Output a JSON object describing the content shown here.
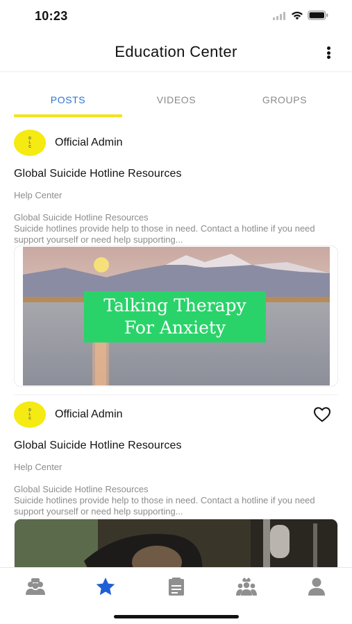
{
  "status_bar": {
    "time": "10:23"
  },
  "header": {
    "title": "Education Center"
  },
  "tabs": [
    {
      "label": "POSTS",
      "active": true
    },
    {
      "label": "VIDEOS",
      "active": false
    },
    {
      "label": "GROUPS",
      "active": false
    }
  ],
  "posts": [
    {
      "author": "Official Admin",
      "avatar_text": [
        "D",
        "L",
        "C"
      ],
      "title": "Global Suicide Hotline Resources",
      "category": "Help Center",
      "excerpt_title": "Global Suicide Hotline Resources",
      "excerpt": "Suicide hotlines provide help to those in need. Contact a hotline if you need support yourself or need help supporting...",
      "media": {
        "caption_line1": "Talking Therapy",
        "caption_line2": "For Anxiety"
      },
      "favorited": false,
      "show_heart": false
    },
    {
      "author": "Official Admin",
      "avatar_text": [
        "D",
        "L",
        "C"
      ],
      "title": "Global Suicide Hotline Resources",
      "category": "Help Center",
      "excerpt_title": "Global Suicide Hotline Resources",
      "excerpt": "Suicide hotlines provide help to those in need. Contact a hotline if you need support yourself or need help supporting...",
      "favorited": false,
      "show_heart": true
    }
  ],
  "bottom_nav": [
    {
      "icon": "community-icon",
      "active": false
    },
    {
      "icon": "star-icon",
      "active": true
    },
    {
      "icon": "notes-icon",
      "active": false
    },
    {
      "icon": "groups-icon",
      "active": false
    },
    {
      "icon": "profile-icon",
      "active": false
    }
  ],
  "colors": {
    "accent_blue": "#2d73d6",
    "tab_underline": "#f4e21c",
    "avatar_yellow": "#f5ea12",
    "caption_green": "#2ad36a",
    "nav_inactive": "#8f8f8f"
  }
}
